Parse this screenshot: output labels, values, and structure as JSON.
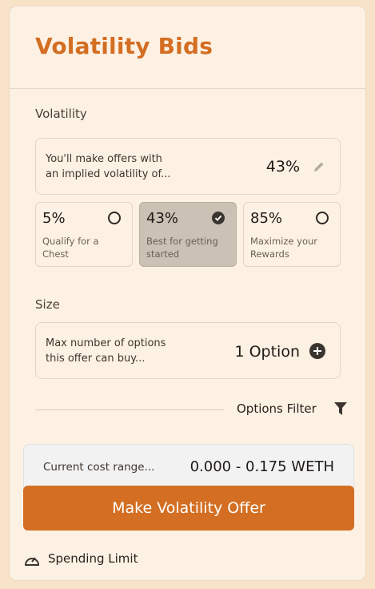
{
  "title": "Volatility Bids",
  "volatility": {
    "label": "Volatility",
    "description_line1": "You'll make offers with",
    "description_line2": "an implied volatility of...",
    "value": "43%",
    "edit_icon": "pencil-icon",
    "options": [
      {
        "pct": "5%",
        "sub_line1": "Qualify for a",
        "sub_line2": "Chest",
        "selected": false
      },
      {
        "pct": "43%",
        "sub_line1": "Best for getting",
        "sub_line2": "started",
        "selected": true
      },
      {
        "pct": "85%",
        "sub_line1": "Maximize your",
        "sub_line2": "Rewards",
        "selected": false
      }
    ]
  },
  "size": {
    "label": "Size",
    "description_line1": "Max number of options",
    "description_line2": "this offer can buy...",
    "value": "1 Option",
    "add_icon": "plus-circle-icon"
  },
  "filter": {
    "label": "Options Filter",
    "icon": "funnel-icon"
  },
  "cost": {
    "label": "Current cost range...",
    "value": "0.000 - 0.175 WETH"
  },
  "offer_button": "Make Volatility Offer",
  "spending_limit": {
    "label": "Spending Limit",
    "icon": "gauge-icon"
  },
  "colors": {
    "accent": "#d36e22",
    "background": "#fcf1e3",
    "selected": "#cbc1b5"
  }
}
